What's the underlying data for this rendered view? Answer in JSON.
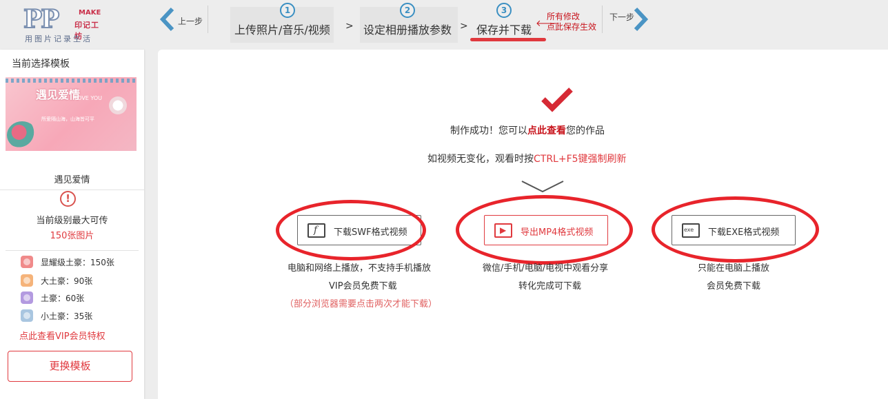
{
  "logo": {
    "mark": "PP",
    "make": "MAKE",
    "brand": "印记工坊",
    "slogan": "用图片记录生活"
  },
  "nav": {
    "prev_label": "上一步",
    "next_label": "下一步",
    "separator": ">",
    "steps": [
      {
        "num": "1",
        "label": "上传照片/音乐/视频"
      },
      {
        "num": "2",
        "label": "设定相册播放参数"
      },
      {
        "num": "3",
        "label": "保存并下载"
      }
    ],
    "save_note_line1": "所有修改",
    "save_note_line2": "点此保存生效",
    "save_note_arrow": "🡐"
  },
  "sidebar": {
    "title": "当前选择模板",
    "thumbnail": {
      "title": "遇见爱情",
      "subtitle": "LOVE YOU",
      "caption": "所爱隔山海，山海皆可平"
    },
    "template_name": "遇见爱情",
    "warn_glyph": "!",
    "limit_text": "当前级别最大可传",
    "limit_value": "150张图片",
    "levels": [
      {
        "text": "显耀级土豪：150张",
        "color": "#f08a8a"
      },
      {
        "text": "大土豪：90张",
        "color": "#f5b37a"
      },
      {
        "text": "土豪：60张",
        "color": "#b39ae0"
      },
      {
        "text": "小土豪：35张",
        "color": "#a9c6e0"
      }
    ],
    "vip_link": "点此查看VIP会员特权",
    "change_button": "更换模板"
  },
  "main": {
    "success_prefix": "制作成功！您可以",
    "success_link": "点此查看",
    "success_suffix": "您的作品",
    "refresh_prefix": "如视频无变化，观看时按",
    "refresh_red": "CTRL+F5键强制刷新",
    "downloads": [
      {
        "label": "下载SWF格式视频",
        "icon_glyph": "f",
        "desc1": "电脑和网络上播放，不支持手机播放",
        "desc2": "VIP会员免费下载",
        "desc3": "（部分浏览器需要点击两次才能下载）"
      },
      {
        "label": "导出MP4格式视频",
        "icon_glyph": "▶",
        "desc1": "微信/手机/电脑/电视中观看分享",
        "desc2": "转化完成可下载"
      },
      {
        "label": "下载EXE格式视频",
        "icon_glyph": "exe",
        "desc1": "只能在电脑上播放",
        "desc2": "会员免费下载"
      }
    ]
  },
  "colors": {
    "accent": "#e0393e",
    "step_blue": "#3a8fc2",
    "annotation_red": "#e8242b"
  },
  "icons": [
    "chevron-left-icon",
    "chevron-right-icon",
    "check-icon",
    "warning-icon",
    "flash-icon",
    "play-icon",
    "exe-icon",
    "tv-antenna-icon"
  ]
}
